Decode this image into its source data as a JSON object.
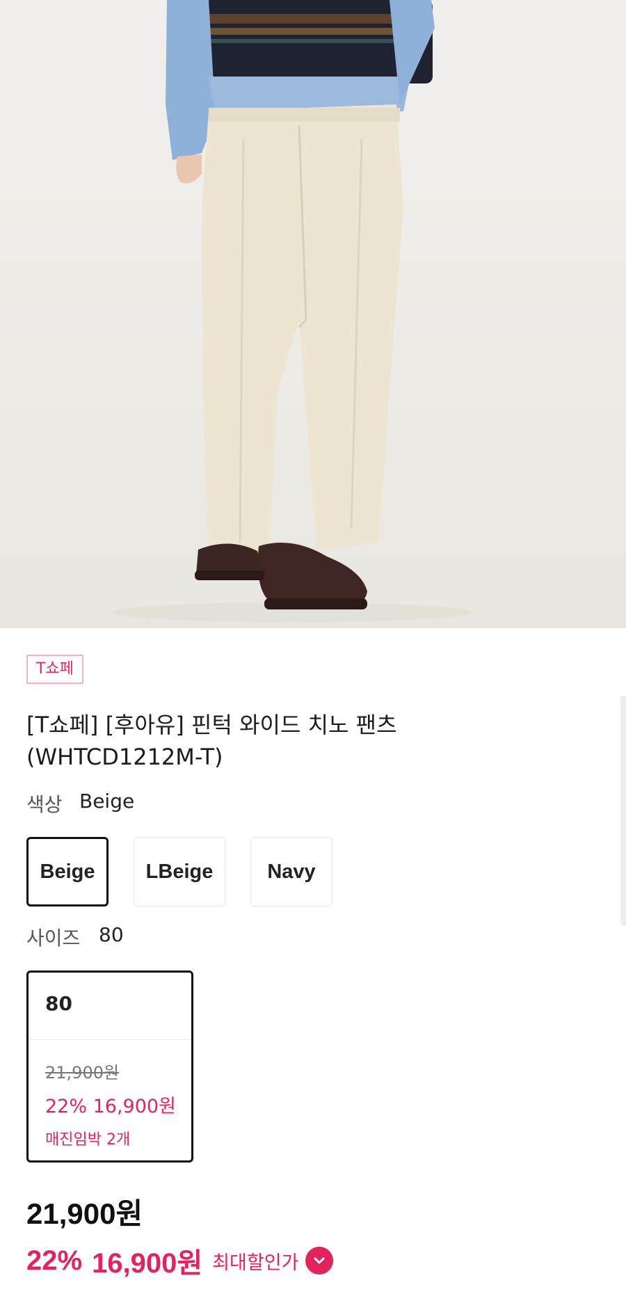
{
  "product": {
    "channel_badge": "T쇼페",
    "title_line1": "[T쇼페] [후아유] 핀턱 와이드 치노 팬츠",
    "title_line2": "(WHTCD1212M-T)"
  },
  "color_option": {
    "label": "색상",
    "selected_value": "Beige",
    "choices": [
      {
        "label": "Beige",
        "selected": true
      },
      {
        "label": "LBeige",
        "selected": false
      },
      {
        "label": "Navy",
        "selected": false
      }
    ]
  },
  "size_option": {
    "label": "사이즈",
    "selected_value": "80",
    "card": {
      "size": "80",
      "original_price": "21,900원",
      "sale_price": "22% 16,900원",
      "stock_note": "매진임박 2개"
    }
  },
  "price": {
    "original": "21,900원",
    "discount_rate": "22%",
    "sale": "16,900원",
    "max_discount_label": "최대할인가"
  },
  "colors": {
    "accent": "#e0245e",
    "badge_border": "#f2b3c0",
    "selected_border": "#111111"
  },
  "icons": {
    "max_discount_toggle": "chevron-down-icon"
  }
}
